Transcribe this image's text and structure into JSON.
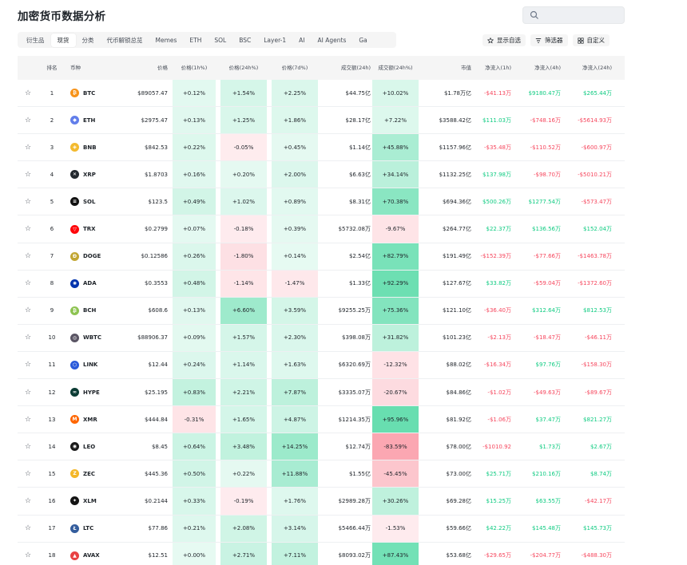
{
  "page_title": "加密货币数据分析",
  "search": {
    "placeholder": ""
  },
  "tabs": [
    "衍生品",
    "现货",
    "分类",
    "代币解锁总览",
    "Memes",
    "ETH",
    "SOL",
    "BSC",
    "Layer-1",
    "AI",
    "AI Agents",
    "Ga"
  ],
  "active_tab": 1,
  "actions": [
    {
      "label": "显示自选",
      "icon": "star-icon"
    },
    {
      "label": "筛选器",
      "icon": "filter-icon"
    },
    {
      "label": "自定义",
      "icon": "customize-icon"
    }
  ],
  "columns": {
    "rank": "排名",
    "coin": "币种",
    "price": "价格",
    "chg1h": "价格(1h%)",
    "chg24h": "价格(24h%)",
    "chg7d": "价格(7d%)",
    "vol24h": "成交额(24h)",
    "volchg": "成交额(24h%)",
    "mcap": "市值",
    "net1h": "净流入(1h)",
    "net4h": "净流入(4h)",
    "net24h": "净流入(24h)"
  },
  "colors": {
    "green_text": "#0ecb81",
    "red_text": "#f6465d",
    "header_bg": "#f5f5f5"
  },
  "rows": [
    {
      "rank": "1",
      "symbol": "BTC",
      "icon_color": "#f7931a",
      "icon_glyph": "₿",
      "price": "$89057.47",
      "chg1h": "+0.12%",
      "chg24h": "+1.54%",
      "chg7d": "+2.25%",
      "vol": "$44.75亿",
      "volchg": "+10.02%",
      "mcap": "$1.78万亿",
      "n1": "-$41.13万",
      "n4": "$9180.47万",
      "n24": "$265.44万"
    },
    {
      "rank": "2",
      "symbol": "ETH",
      "icon_color": "#627eea",
      "icon_glyph": "◆",
      "price": "$2975.47",
      "chg1h": "+0.13%",
      "chg24h": "+1.25%",
      "chg7d": "+1.86%",
      "vol": "$28.17亿",
      "volchg": "+7.22%",
      "mcap": "$3588.42亿",
      "n1": "$111.03万",
      "n4": "-$748.16万",
      "n24": "-$5614.93万"
    },
    {
      "rank": "3",
      "symbol": "BNB",
      "icon_color": "#f3ba2f",
      "icon_glyph": "◈",
      "price": "$842.53",
      "chg1h": "+0.22%",
      "chg24h": "-0.05%",
      "chg7d": "+0.45%",
      "vol": "$1.14亿",
      "volchg": "+45.88%",
      "mcap": "$1157.96亿",
      "n1": "-$35.48万",
      "n4": "-$110.52万",
      "n24": "-$600.97万"
    },
    {
      "rank": "4",
      "symbol": "XRP",
      "icon_color": "#23292f",
      "icon_glyph": "✕",
      "price": "$1.8703",
      "chg1h": "+0.16%",
      "chg24h": "+0.20%",
      "chg7d": "+2.00%",
      "vol": "$6.63亿",
      "volchg": "+34.14%",
      "mcap": "$1132.25亿",
      "n1": "$137.98万",
      "n4": "-$98.70万",
      "n24": "-$5010.21万"
    },
    {
      "rank": "5",
      "symbol": "SOL",
      "icon_color": "#111111",
      "icon_glyph": "≡",
      "price": "$123.5",
      "chg1h": "+0.49%",
      "chg24h": "+1.02%",
      "chg7d": "+0.89%",
      "vol": "$8.31亿",
      "volchg": "+70.38%",
      "mcap": "$694.36亿",
      "n1": "$500.26万",
      "n4": "$1277.54万",
      "n24": "-$573.47万"
    },
    {
      "rank": "6",
      "symbol": "TRX",
      "icon_color": "#ff060a",
      "icon_glyph": "▽",
      "price": "$0.2799",
      "chg1h": "+0.07%",
      "chg24h": "-0.18%",
      "chg7d": "+0.39%",
      "vol": "$5732.08万",
      "volchg": "-9.67%",
      "mcap": "$264.77亿",
      "n1": "$22.37万",
      "n4": "$136.56万",
      "n24": "$152.04万"
    },
    {
      "rank": "7",
      "symbol": "DOGE",
      "icon_color": "#c2a633",
      "icon_glyph": "Ð",
      "price": "$0.12586",
      "chg1h": "+0.26%",
      "chg24h": "-1.80%",
      "chg7d": "+0.14%",
      "vol": "$2.54亿",
      "volchg": "+82.79%",
      "mcap": "$191.49亿",
      "n1": "-$152.39万",
      "n4": "-$77.66万",
      "n24": "-$1463.78万"
    },
    {
      "rank": "8",
      "symbol": "ADA",
      "icon_color": "#0033ad",
      "icon_glyph": "✺",
      "price": "$0.3553",
      "chg1h": "+0.48%",
      "chg24h": "-1.14%",
      "chg7d": "-1.47%",
      "vol": "$1.33亿",
      "volchg": "+92.29%",
      "mcap": "$127.67亿",
      "n1": "$33.82万",
      "n4": "-$59.04万",
      "n24": "-$1372.60万"
    },
    {
      "rank": "9",
      "symbol": "BCH",
      "icon_color": "#8dc351",
      "icon_glyph": "₿",
      "price": "$608.6",
      "chg1h": "+0.13%",
      "chg24h": "+6.60%",
      "chg7d": "+3.59%",
      "vol": "$9255.25万",
      "volchg": "+75.36%",
      "mcap": "$121.10亿",
      "n1": "-$36.40万",
      "n4": "$312.64万",
      "n24": "$812.53万"
    },
    {
      "rank": "10",
      "symbol": "WBTC",
      "icon_color": "#5a5564",
      "icon_glyph": "◎",
      "price": "$88906.37",
      "chg1h": "+0.09%",
      "chg24h": "+1.57%",
      "chg7d": "+2.30%",
      "vol": "$398.08万",
      "volchg": "+31.82%",
      "mcap": "$101.23亿",
      "n1": "-$2.13万",
      "n4": "-$18.47万",
      "n24": "-$46.11万"
    },
    {
      "rank": "11",
      "symbol": "LINK",
      "icon_color": "#2a5ada",
      "icon_glyph": "⬡",
      "price": "$12.44",
      "chg1h": "+0.24%",
      "chg24h": "+1.14%",
      "chg7d": "+1.63%",
      "vol": "$6320.69万",
      "volchg": "-12.32%",
      "mcap": "$88.02亿",
      "n1": "-$16.34万",
      "n4": "$97.76万",
      "n24": "-$158.30万"
    },
    {
      "rank": "12",
      "symbol": "HYPE",
      "icon_color": "#0b3b34",
      "icon_glyph": "∞",
      "price": "$25.195",
      "chg1h": "+0.83%",
      "chg24h": "+2.21%",
      "chg7d": "+7.87%",
      "vol": "$3335.07万",
      "volchg": "-20.67%",
      "mcap": "$84.86亿",
      "n1": "-$1.02万",
      "n4": "-$49.63万",
      "n24": "-$89.67万"
    },
    {
      "rank": "13",
      "symbol": "XMR",
      "icon_color": "#ff6600",
      "icon_glyph": "M",
      "price": "$444.84",
      "chg1h": "-0.31%",
      "chg24h": "+1.65%",
      "chg7d": "+4.87%",
      "vol": "$1214.35万",
      "volchg": "+95.96%",
      "mcap": "$81.92亿",
      "n1": "-$1.06万",
      "n4": "$37.47万",
      "n24": "$821.27万"
    },
    {
      "rank": "14",
      "symbol": "LEO",
      "icon_color": "#1a1a1a",
      "icon_glyph": "◉",
      "price": "$8.45",
      "chg1h": "+0.64%",
      "chg24h": "+3.48%",
      "chg7d": "+14.25%",
      "vol": "$12.74万",
      "volchg": "-83.59%",
      "mcap": "$78.00亿",
      "n1": "-$1010.92",
      "n4": "$1.73万",
      "n24": "$2.67万"
    },
    {
      "rank": "15",
      "symbol": "ZEC",
      "icon_color": "#f4b728",
      "icon_glyph": "Z",
      "price": "$445.36",
      "chg1h": "+0.50%",
      "chg24h": "+0.22%",
      "chg7d": "+11.88%",
      "vol": "$1.55亿",
      "volchg": "-45.45%",
      "mcap": "$73.00亿",
      "n1": "$25.71万",
      "n4": "$210.16万",
      "n24": "$8.74万"
    },
    {
      "rank": "16",
      "symbol": "XLM",
      "icon_color": "#141414",
      "icon_glyph": "✦",
      "price": "$0.2144",
      "chg1h": "+0.33%",
      "chg24h": "-0.19%",
      "chg7d": "+1.76%",
      "vol": "$2989.28万",
      "volchg": "+30.26%",
      "mcap": "$69.28亿",
      "n1": "$15.25万",
      "n4": "$63.55万",
      "n24": "-$42.17万"
    },
    {
      "rank": "17",
      "symbol": "LTC",
      "icon_color": "#345d9d",
      "icon_glyph": "Ł",
      "price": "$77.86",
      "chg1h": "+0.21%",
      "chg24h": "+2.08%",
      "chg7d": "+3.14%",
      "vol": "$5466.44万",
      "volchg": "-1.53%",
      "mcap": "$59.66亿",
      "n1": "$42.22万",
      "n4": "$145.48万",
      "n24": "$145.73万"
    },
    {
      "rank": "18",
      "symbol": "AVAX",
      "icon_color": "#e84142",
      "icon_glyph": "▲",
      "price": "$12.51",
      "chg1h": "+0.00%",
      "chg24h": "+2.71%",
      "chg7d": "+7.11%",
      "vol": "$8093.02万",
      "volchg": "+87.43%",
      "mcap": "$53.68亿",
      "n1": "-$29.65万",
      "n4": "-$204.77万",
      "n24": "-$488.30万"
    }
  ]
}
